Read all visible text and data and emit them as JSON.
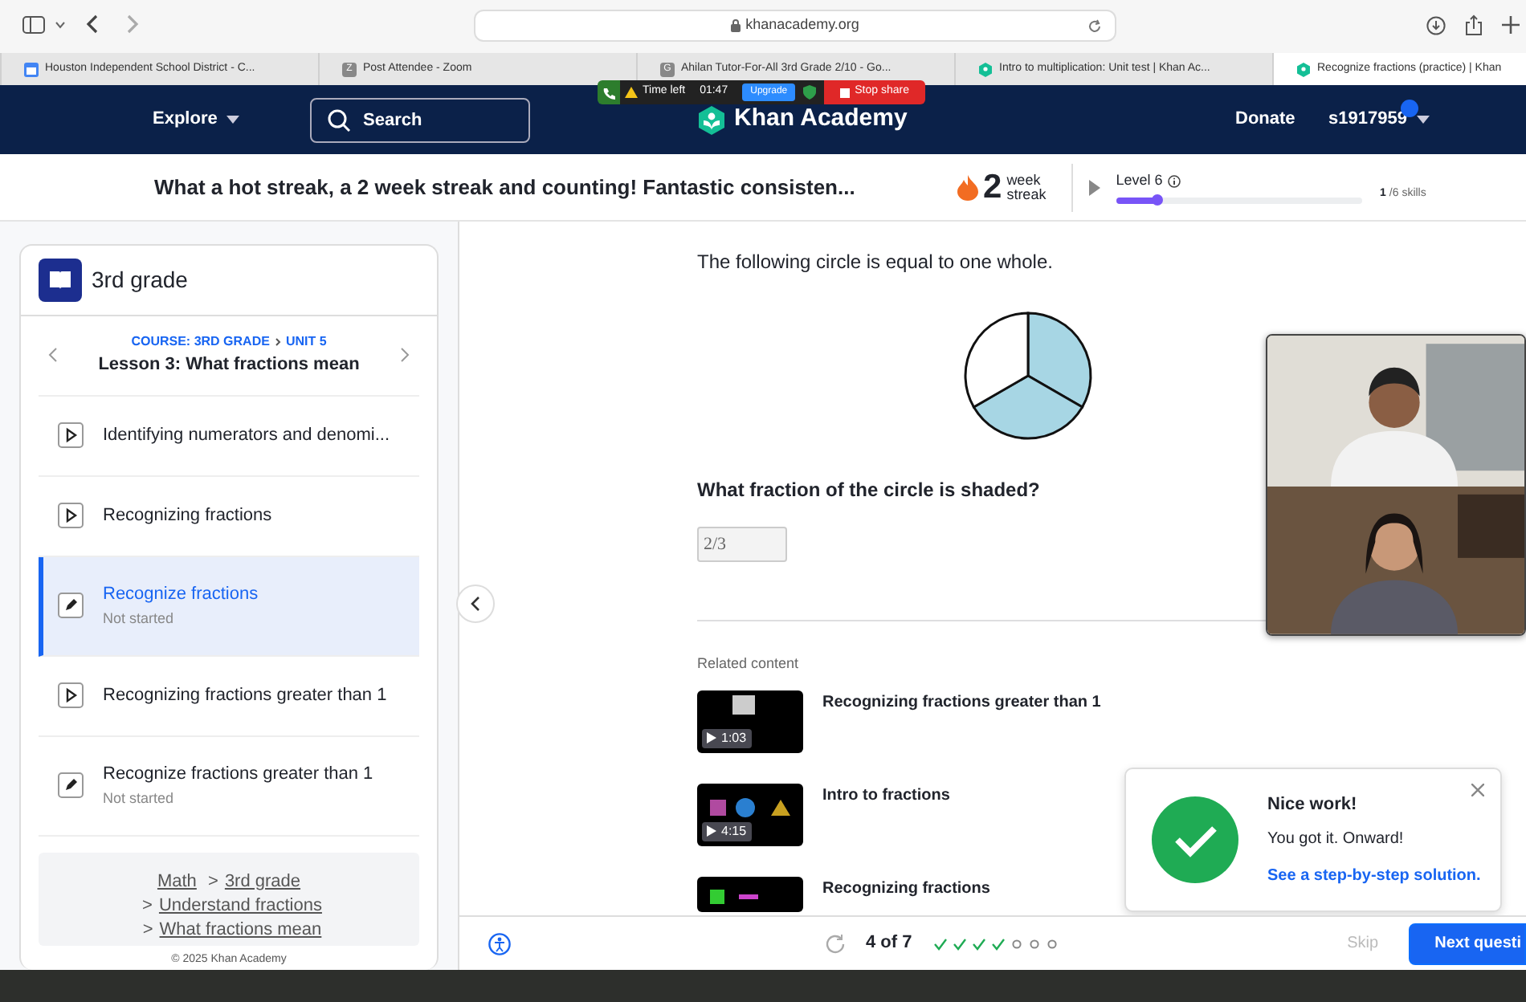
{
  "browser": {
    "address": "khanacademy.org",
    "tabs": [
      {
        "title": "Houston Independent School District - C...",
        "kind": "calendar",
        "selected": false
      },
      {
        "title": "Post Attendee - Zoom",
        "kind": "letter",
        "letter": "Z",
        "selected": false
      },
      {
        "title": "Ahilan Tutor-For-All 3rd Grade 2/10 - Go...",
        "kind": "letter",
        "letter": "G",
        "selected": false
      },
      {
        "title": "Intro to multiplication: Unit test | Khan Ac...",
        "kind": "khan",
        "selected": false
      },
      {
        "title": "Recognize fractions (practice) | Khan",
        "kind": "khan",
        "selected": true
      }
    ]
  },
  "navbar": {
    "explore": "Explore",
    "search": "Search",
    "logo": "Khan Academy",
    "donate": "Donate",
    "user": "s1917959"
  },
  "share_bar": {
    "time_label": "Time left",
    "time": "01:47",
    "upgrade": "Upgrade",
    "stop": "Stop share"
  },
  "streak_bar": {
    "message": "What a hot streak, a 2 week streak and counting! Fantastic consisten...",
    "count": "2",
    "unit": "week streak",
    "level_label": "Level 6",
    "level": 0.17,
    "skills_done": "1",
    "skills_total": "/6 skills"
  },
  "sidebar": {
    "course": "3rd grade",
    "course_link": "COURSE: 3RD GRADE",
    "unit_link": "UNIT 5",
    "lesson": "Lesson 3: What fractions mean",
    "items": [
      {
        "kind": "video",
        "title": "Identifying numerators and denomi...",
        "selected": false
      },
      {
        "kind": "video",
        "title": "Recognizing fractions",
        "selected": false
      },
      {
        "kind": "exercise",
        "title": "Recognize fractions",
        "status": "Not started",
        "selected": true
      },
      {
        "kind": "video",
        "title": "Recognizing fractions greater than 1",
        "selected": false
      },
      {
        "kind": "exercise",
        "title": "Recognize fractions greater than 1",
        "status": "Not started",
        "selected": false
      }
    ],
    "breadcrumbs": [
      "Math",
      "3rd grade",
      "Understand fractions",
      "What fractions mean"
    ],
    "separator": ">",
    "footer": "© 2025 Khan Academy"
  },
  "question": {
    "prompt": "The following circle is equal to one whole.",
    "slices": [
      {
        "shaded": true
      },
      {
        "shaded": true
      },
      {
        "shaded": false
      }
    ],
    "ask": "What fraction of the circle is shaded?",
    "answer": "2/3"
  },
  "related": {
    "heading": "Related content",
    "items": [
      {
        "title": "Recognizing fractions greater than 1",
        "duration": "1:03"
      },
      {
        "title": "Intro to fractions",
        "duration": "4:15"
      },
      {
        "title": "Recognizing fractions"
      }
    ]
  },
  "toast": {
    "title": "Nice work!",
    "body": "You got it. Onward!",
    "link": "See a step-by-step solution."
  },
  "footer_bar": {
    "progress": "4 of 7",
    "steps": [
      {
        "done": true
      },
      {
        "done": true
      },
      {
        "done": true
      },
      {
        "done": true
      },
      {
        "done": false
      },
      {
        "done": false
      },
      {
        "done": false
      }
    ],
    "skip": "Skip",
    "next": "Next questi"
  }
}
